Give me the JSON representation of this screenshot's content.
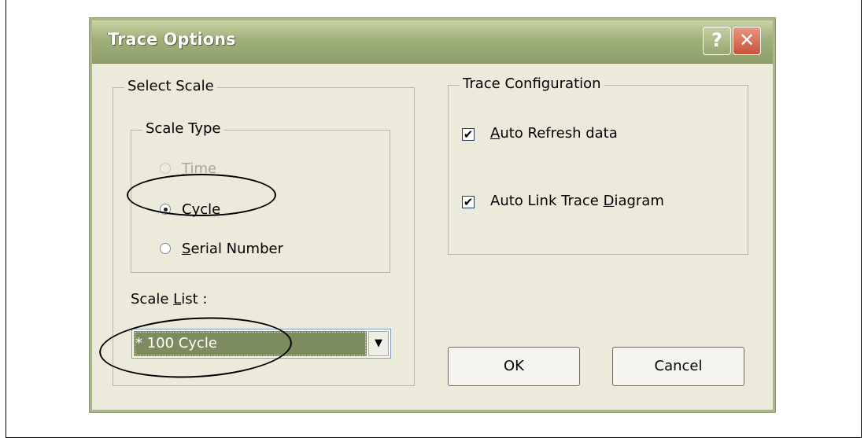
{
  "dialog": {
    "title": "Trace Options",
    "help_glyph": "?",
    "close_glyph": "✕"
  },
  "select_scale": {
    "legend": "Select Scale",
    "scale_type": {
      "legend": "Scale Type",
      "options": [
        {
          "label": "Time",
          "underline": "T",
          "rest": "ime",
          "selected": false,
          "enabled": false
        },
        {
          "label": "Cycle",
          "underline": "C",
          "rest": "ycle",
          "selected": true,
          "enabled": true
        },
        {
          "label": "Serial Number",
          "underline": "S",
          "rest": "erial Number",
          "selected": false,
          "enabled": true
        }
      ]
    },
    "scale_list": {
      "label_prefix": "Scale ",
      "label_underline": "L",
      "label_rest": "ist :",
      "selected_value": "* 100 Cycle",
      "arrow": "▼"
    }
  },
  "trace_config": {
    "legend": "Trace Configuration",
    "auto_refresh": {
      "underline": "A",
      "rest": "uto Refresh data",
      "checked": true
    },
    "auto_link": {
      "prefix": "Auto Link Trace ",
      "underline": "D",
      "rest": "iagram",
      "checked": true
    },
    "check_glyph": "✔"
  },
  "buttons": {
    "ok": "OK",
    "cancel": "Cancel"
  }
}
